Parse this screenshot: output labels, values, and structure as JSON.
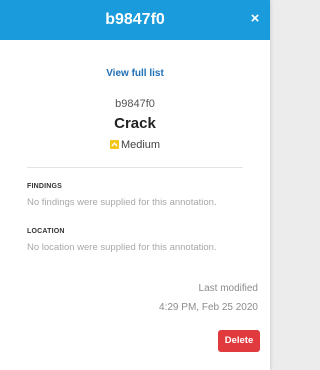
{
  "header": {
    "title": "b9847f0",
    "close_symbol": "×"
  },
  "link": {
    "view_full_list": "View full list"
  },
  "annotation": {
    "id": "b9847f0",
    "type": "Crack",
    "severity": "Medium",
    "severity_icon": "chevron-up-icon",
    "severity_color": "#f3c61a"
  },
  "findings": {
    "label": "FINDINGS",
    "text": "No findings were supplied for this annotation."
  },
  "location": {
    "label": "LOCATION",
    "text": "No location were supplied for this annotation."
  },
  "modified": {
    "label": "Last modified",
    "date": "4:29 PM, Feb 25 2020"
  },
  "actions": {
    "delete_label": "Delete"
  },
  "colors": {
    "header": "#1a9bdb",
    "link": "#1f6fb5",
    "delete": "#e03a3e"
  }
}
